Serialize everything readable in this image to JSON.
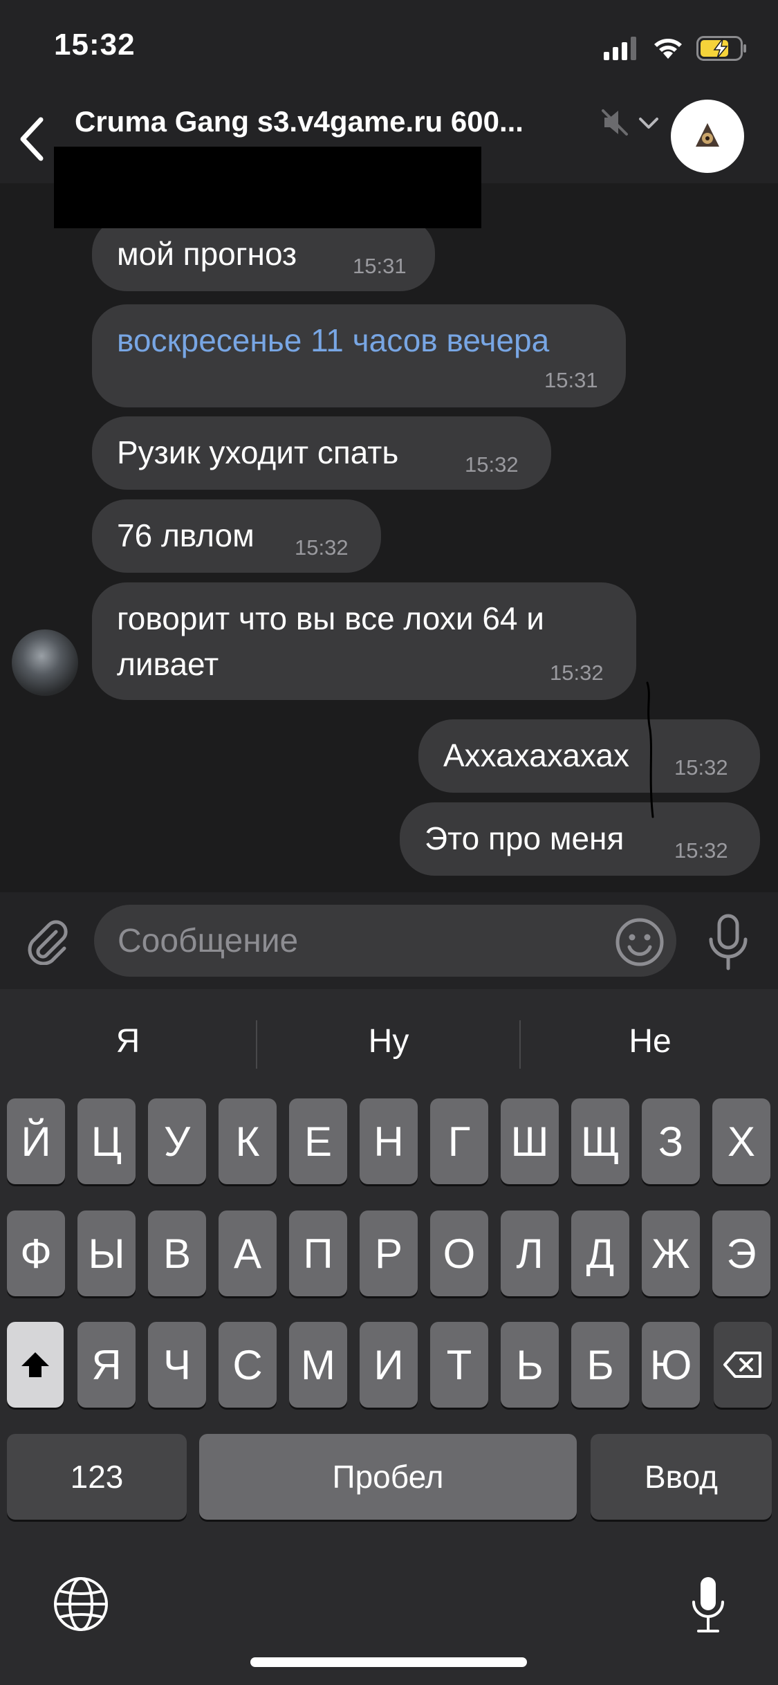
{
  "status_bar": {
    "time": "15:32"
  },
  "header": {
    "back_icon": "chevron-left-icon",
    "title": "Cruma Gang s3.v4game.ru 600...",
    "mute_icon": "muted-speaker-icon",
    "chevron_icon": "chevron-down-icon"
  },
  "messages": [
    {
      "text": "мой прогноз",
      "time": "15:31",
      "direction": "incoming"
    },
    {
      "text": "воскресенье 11 часов вечера",
      "time": "15:31",
      "direction": "incoming",
      "style": "link"
    },
    {
      "text": "Рузик уходит спать",
      "time": "15:32",
      "direction": "incoming"
    },
    {
      "text": "76 лвлом",
      "time": "15:32",
      "direction": "incoming"
    },
    {
      "text_lines": [
        "говорит что вы все лохи 64 и",
        "ливает"
      ],
      "time": "15:32",
      "direction": "incoming"
    },
    {
      "text": "Аххахахахах",
      "time": "15:32",
      "direction": "outgoing"
    },
    {
      "text": "Это про меня",
      "time": "15:32",
      "direction": "outgoing"
    }
  ],
  "composer": {
    "placeholder": "Сообщение",
    "attach_icon": "paperclip-icon",
    "emoji_icon": "smiley-icon",
    "mic_icon": "microphone-icon"
  },
  "keyboard": {
    "suggestions": [
      "Я",
      "Ну",
      "Не"
    ],
    "row1": [
      "Й",
      "Ц",
      "У",
      "К",
      "Е",
      "Н",
      "Г",
      "Ш",
      "Щ",
      "З",
      "Х"
    ],
    "row2": [
      "Ф",
      "Ы",
      "В",
      "А",
      "П",
      "Р",
      "О",
      "Л",
      "Д",
      "Ж",
      "Э"
    ],
    "row3": [
      "Я",
      "Ч",
      "С",
      "М",
      "И",
      "Т",
      "Ь",
      "Б",
      "Ю"
    ],
    "numbers_label": "123",
    "space_label": "Пробел",
    "return_label": "Ввод",
    "shift_icon": "shift-icon",
    "backspace_icon": "backspace-icon",
    "globe_icon": "globe-icon",
    "dictation_icon": "microphone-icon"
  },
  "colors": {
    "background": "#1c1c1d",
    "bubble": "#3a3a3c",
    "link": "#78a6e4",
    "time": "#9a9a9f",
    "battery_charging": "#f5d33a"
  }
}
